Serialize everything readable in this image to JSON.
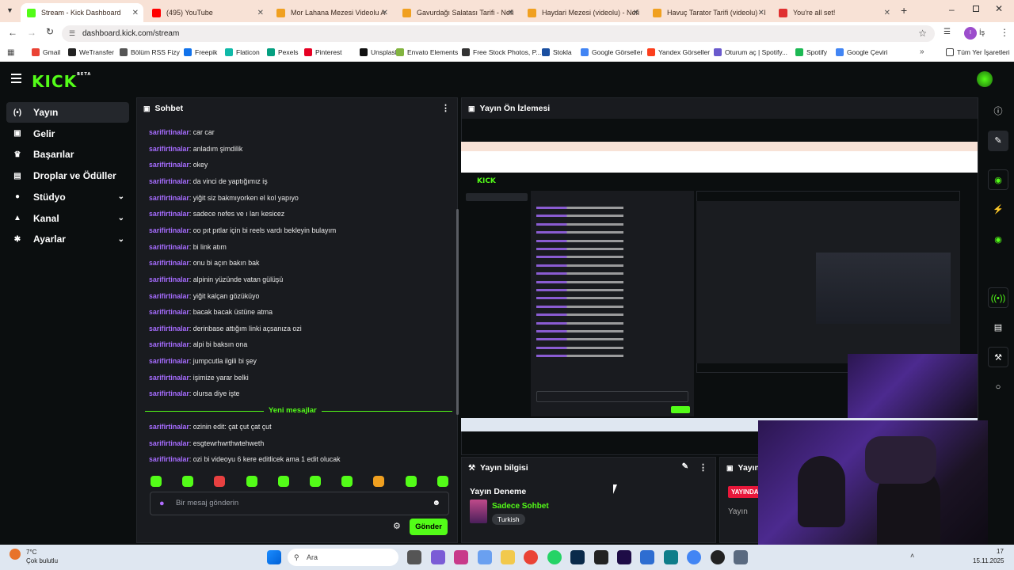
{
  "browser": {
    "tabs": [
      {
        "label": "Stream - Kick Dashboard",
        "active": true,
        "color": "#53fc18"
      },
      {
        "label": "(495) YouTube",
        "color": "#ff0000"
      },
      {
        "label": "Mor Lahana Mezesi Videolu A",
        "color": "#f0a020"
      },
      {
        "label": "Gavurdağı Salatası Tarifi - Nefi",
        "color": "#f0a020"
      },
      {
        "label": "Haydari Mezesi (videolu) - Nefi",
        "color": "#f0a020"
      },
      {
        "label": "Havuç Tarator Tarifi (videolu) - I",
        "color": "#f0a020"
      },
      {
        "label": "You're all set!",
        "color": "#e03030"
      }
    ],
    "url": "dashboard.kick.com/stream",
    "profile_initial": "İş",
    "bookmarks": [
      {
        "label": "Gmail",
        "color": "#ea4335"
      },
      {
        "label": "WeTransfer",
        "color": "#222222"
      },
      {
        "label": "Bölüm RSS Fizy",
        "color": "#555555"
      },
      {
        "label": "Freepik",
        "color": "#1273eb"
      },
      {
        "label": "Flaticon",
        "color": "#0fb9a8"
      },
      {
        "label": "Pexels",
        "color": "#05a081"
      },
      {
        "label": "Pinterest",
        "color": "#e60023"
      },
      {
        "label": "Unsplash",
        "color": "#111111"
      },
      {
        "label": "Envato Elements",
        "color": "#82b440"
      },
      {
        "label": "Free Stock Photos, P...",
        "color": "#333333"
      },
      {
        "label": "Stokla",
        "color": "#1a4fa0"
      },
      {
        "label": "Google Görseller",
        "color": "#4285f4"
      },
      {
        "label": "Yandex Görseller",
        "color": "#fc3f1d"
      },
      {
        "label": "Oturum aç | Spotify...",
        "color": "#6a5acd"
      },
      {
        "label": "Spotify",
        "color": "#1db954"
      },
      {
        "label": "Google Çeviri",
        "color": "#4285f4"
      }
    ],
    "all_bookmarks": "Tüm Yer İşaretleri"
  },
  "app": {
    "logo": "KICK",
    "logo_badge": "BETA",
    "accent": "#53fc18",
    "nav": [
      {
        "label": "Yayın",
        "icon": "broadcast-icon",
        "active": true
      },
      {
        "label": "Gelir",
        "icon": "wallet-icon"
      },
      {
        "label": "Başarılar",
        "icon": "trophy-icon"
      },
      {
        "label": "Droplar ve Ödüller",
        "icon": "gift-icon"
      },
      {
        "label": "Stüdyo",
        "icon": "video-icon",
        "expandable": true
      },
      {
        "label": "Kanal",
        "icon": "user-icon",
        "expandable": true
      },
      {
        "label": "Ayarlar",
        "icon": "gear-icon",
        "expandable": true
      }
    ]
  },
  "chat": {
    "title": "Sohbet",
    "messages": [
      {
        "user": "sarifirtinalar",
        "text": "car car"
      },
      {
        "user": "sarifirtinalar",
        "text": "anladım şimdilik"
      },
      {
        "user": "sarifirtinalar",
        "text": "okey"
      },
      {
        "user": "sarifirtinalar",
        "text": "da vinci de yaptığımız iş"
      },
      {
        "user": "sarifirtinalar",
        "text": "yiğit siz bakmıyorken el kol yapıyo"
      },
      {
        "user": "sarifirtinalar",
        "text": "sadece nefes ve ı ları kesicez"
      },
      {
        "user": "sarifirtinalar",
        "text": "oo pıt pıtlar için bi reels vardı bekleyin bulayım"
      },
      {
        "user": "sarifirtinalar",
        "text": "bi link atım"
      },
      {
        "user": "sarifirtinalar",
        "text": "onu bi açın bakın bak"
      },
      {
        "user": "sarifirtinalar",
        "text": "alpinin yüzünde vatan gülüşü"
      },
      {
        "user": "sarifirtinalar",
        "text": "yiğit kalçan gözüküyo"
      },
      {
        "user": "sarifirtinalar",
        "text": "bacak bacak üstüne atma"
      },
      {
        "user": "sarifirtinalar",
        "text": "derinbase attığım linki açsanıza ozi"
      },
      {
        "user": "sarifirtinalar",
        "text": "alpi bi baksın ona"
      },
      {
        "user": "sarifirtinalar",
        "text": "jumpcutla ilgili bi şey"
      },
      {
        "user": "sarifirtinalar",
        "text": "işimize yarar belki"
      },
      {
        "user": "sarifirtinalar",
        "text": "olursa diye işte"
      }
    ],
    "new_messages_label": "Yeni mesajlar",
    "new_messages": [
      {
        "user": "sarifirtinalar",
        "text": "ozinin edit: çat çut çat çut"
      },
      {
        "user": "sarifirtinalar",
        "text": "esgtewrhwrthwtehweth"
      },
      {
        "user": "sarifirtinalar",
        "text": "ozi bi videoyu 6 kere editlicek ama 1 edit olucak"
      }
    ],
    "input_placeholder": "Bir mesaj gönderin",
    "send_label": "Gönder"
  },
  "preview": {
    "title": "Yayın Ön İzlemesi"
  },
  "stream_info": {
    "title": "Yayın bilgisi",
    "stream_title": "Yayın Deneme",
    "category": "Sadece Sohbet",
    "language": "Turkish"
  },
  "partial_panel": {
    "title": "Yayın",
    "badge": "YAYINDA",
    "subtitle": "Yayın"
  },
  "taskbar": {
    "weather_temp": "7°C",
    "weather_desc": "Çok bulutlu",
    "search": "Ara",
    "time_partial": "17",
    "date": "15.11.2025"
  }
}
